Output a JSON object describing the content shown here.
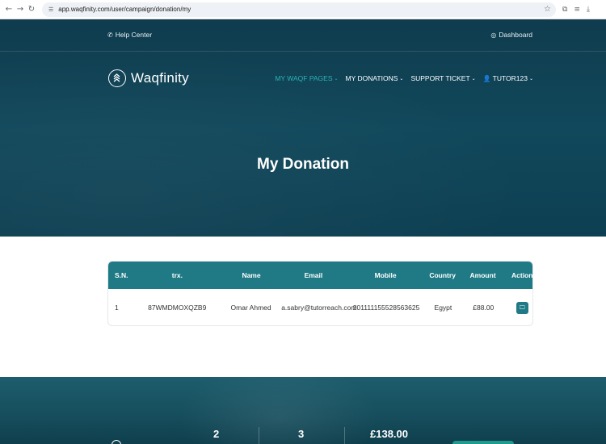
{
  "browser": {
    "url": "app.waqfinity.com/user/campaign/donation/my"
  },
  "topbar": {
    "help_label": "Help Center",
    "dashboard_label": "Dashboard"
  },
  "brand": {
    "name": "Waqfinity"
  },
  "nav": {
    "items": [
      {
        "label": "MY WAQF PAGES",
        "active": true
      },
      {
        "label": "MY DONATIONS",
        "active": false
      },
      {
        "label": "SUPPORT TICKET",
        "active": false
      },
      {
        "label": "TUTOR123",
        "active": false
      }
    ]
  },
  "page": {
    "title": "My Donation"
  },
  "table": {
    "headers": {
      "sn": "S.N.",
      "trx": "trx.",
      "name": "Name",
      "email": "Email",
      "mobile": "Mobile",
      "country": "Country",
      "amount": "Amount",
      "action": "Action"
    },
    "rows": [
      {
        "sn": "1",
        "trx": "87WMDMOXQZB9",
        "name": "Omar Ahmed",
        "email": "a.sabry@tutorreach.com",
        "mobile": "201111155528563625",
        "country": "Egypt",
        "amount": "£88.00"
      }
    ]
  },
  "stats": {
    "values": [
      "2",
      "3",
      "£138.00"
    ]
  },
  "colors": {
    "hero": "#11485b",
    "accent": "#1f7a85",
    "active_nav": "#2bb3b3"
  }
}
